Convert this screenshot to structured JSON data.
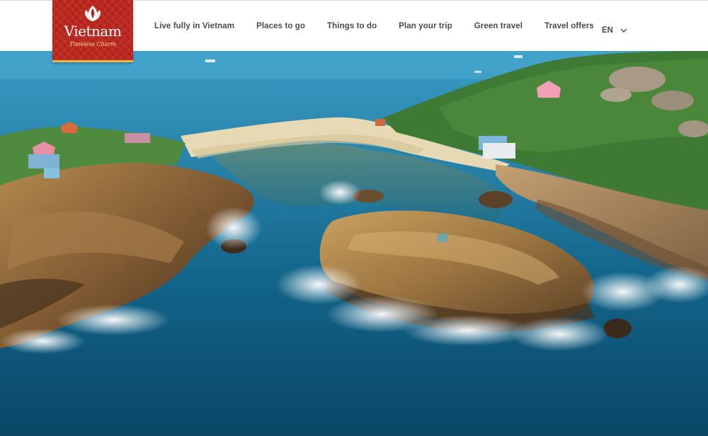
{
  "logo": {
    "wordmark": "Vietnam",
    "tagline": "Timeless Charm",
    "brand_color": "#b7241b",
    "accent_color": "#e9b84a"
  },
  "nav": {
    "items": [
      {
        "label": "Live fully in Vietnam"
      },
      {
        "label": "Places to go"
      },
      {
        "label": "Things to do"
      },
      {
        "label": "Plan your trip"
      },
      {
        "label": "Green travel"
      },
      {
        "label": "Travel offers"
      }
    ],
    "language": {
      "label": "EN",
      "icon": "chevron-down-icon"
    }
  },
  "hero": {
    "icon": "aerial-coast-photo"
  }
}
